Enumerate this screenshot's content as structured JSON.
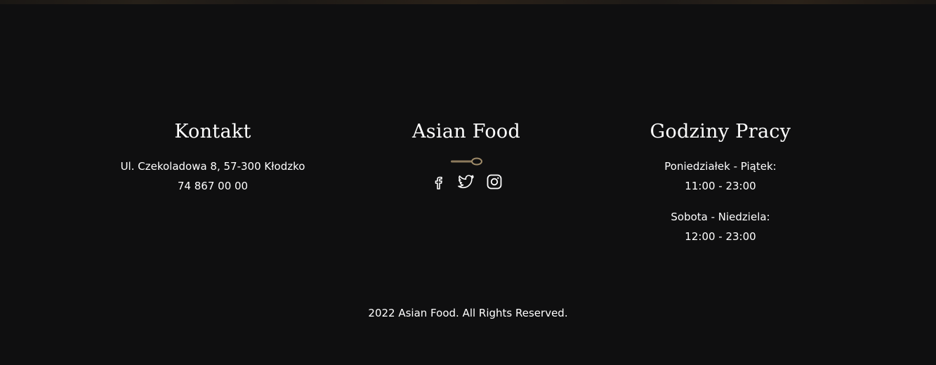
{
  "contact": {
    "heading": "Kontakt",
    "address": "Ul. Czekoladowa 8, 57-300 Kłodzko",
    "phone": "74 867 00 00"
  },
  "brand": {
    "heading": "Asian Food",
    "divider_icon": "spoon-icon",
    "socials": [
      {
        "name": "facebook",
        "icon": "facebook-icon"
      },
      {
        "name": "twitter",
        "icon": "twitter-icon"
      },
      {
        "name": "instagram",
        "icon": "instagram-icon"
      }
    ],
    "accent_color": "#a08c6a"
  },
  "hours": {
    "heading": "Godziny Pracy",
    "weekday_label": "Poniedziałek - Piątek:",
    "weekday_hours": "11:00 - 23:00",
    "weekend_label": "Sobota - Niedziela:",
    "weekend_hours": "12:00 - 23:00"
  },
  "footer": {
    "copyright": "2022 Asian Food. All Rights Reserved."
  },
  "colors": {
    "background": "#0f0f10",
    "text": "#ffffff"
  }
}
